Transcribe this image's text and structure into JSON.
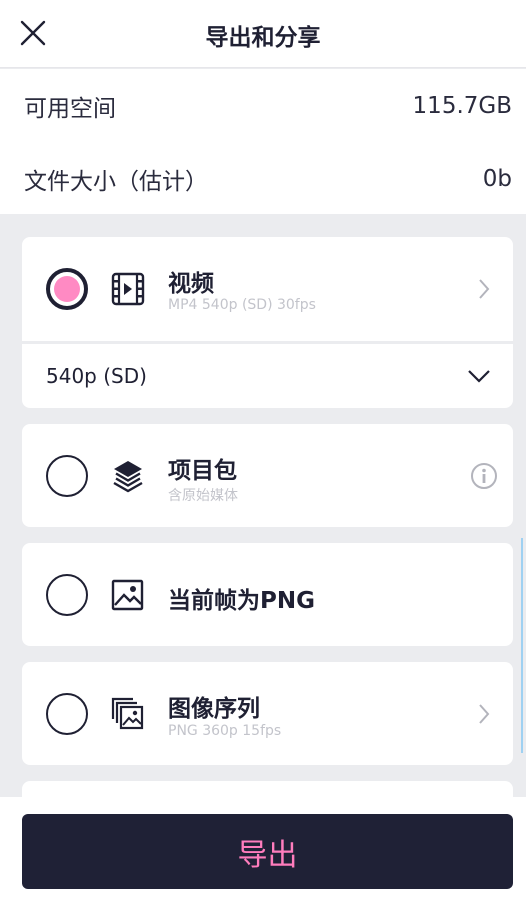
{
  "header": {
    "title": "导出和分享",
    "close_icon": "close-icon"
  },
  "storage": {
    "available_label": "可用空间",
    "available_value": "115.7GB",
    "size_label": "文件大小（估计）",
    "size_value": "0b"
  },
  "options": [
    {
      "id": "video",
      "title": "视频",
      "subtitle": "MP4 540p (SD) 30fps",
      "icon": "film-icon",
      "selected": true,
      "has_chevron": true
    },
    {
      "id": "project",
      "title": "项目包",
      "subtitle": "含原始媒体",
      "icon": "layers-icon",
      "selected": false,
      "has_info": true
    },
    {
      "id": "png-frame",
      "title": "当前帧为PNG",
      "subtitle": "",
      "icon": "image-icon",
      "selected": false
    },
    {
      "id": "image-sequence",
      "title": "图像序列",
      "subtitle": "PNG 360p 15fps",
      "icon": "image-stack-icon",
      "selected": false,
      "has_chevron": true
    }
  ],
  "resolution": {
    "selected": "540p (SD)",
    "icon": "chevron-down-icon"
  },
  "export_button": {
    "label": "导出"
  },
  "colors": {
    "accent_pink": "#ff8ac3",
    "dark_navy": "#1f2136",
    "background": "#ebecef"
  }
}
